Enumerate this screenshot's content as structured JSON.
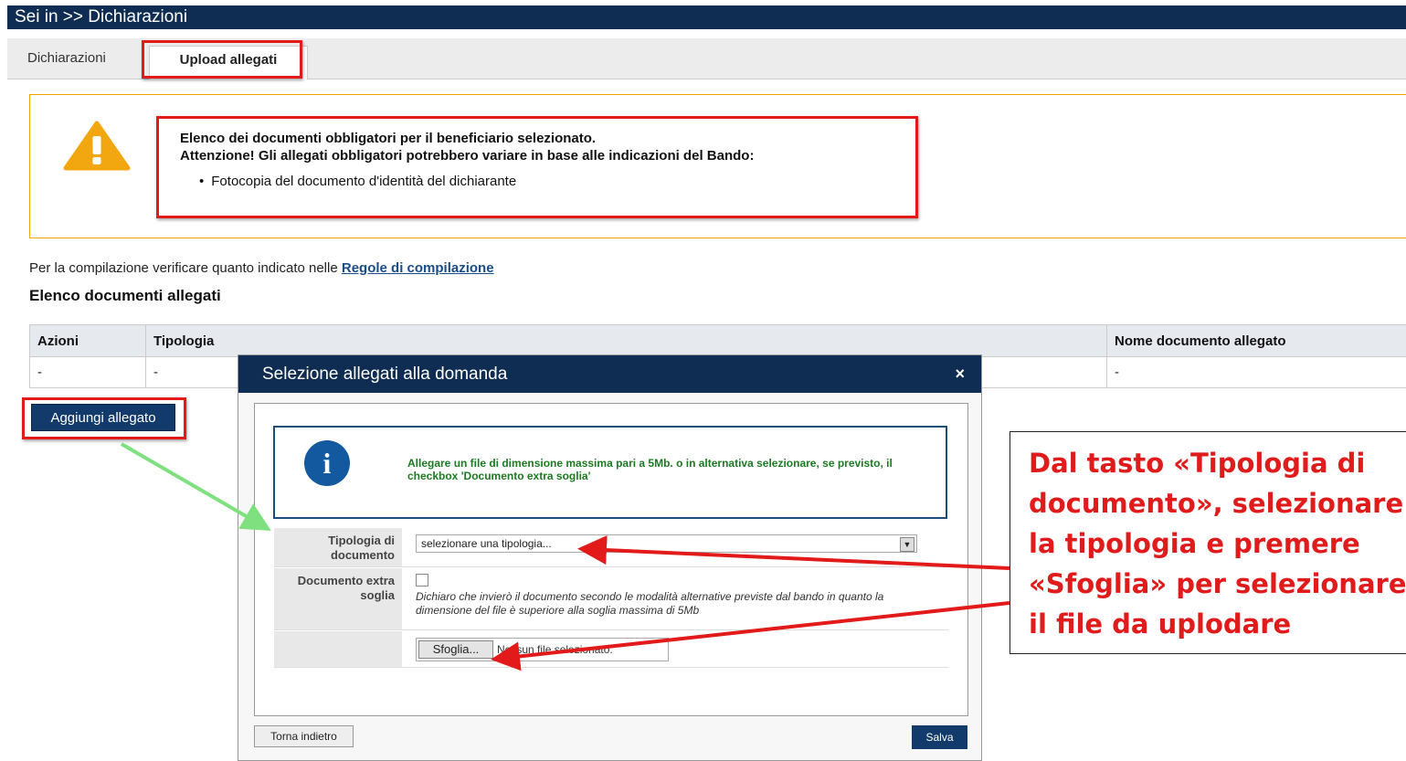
{
  "header": {
    "title": "Sei in >> Dichiarazioni"
  },
  "tabs": [
    {
      "label": "Dichiarazioni"
    },
    {
      "label": "Upload allegati"
    }
  ],
  "alert": {
    "line1": "Elenco dei documenti obbligatori per il beneficiario selezionato.",
    "line2": "Attenzione! Gli allegati obbligatori potrebbero variare in base alle indicazioni del Bando:",
    "item": "Fotocopia del documento d'identità del dichiarante"
  },
  "rules": {
    "prefix": "Per la compilazione verificare quanto indicato nelle ",
    "link": "Regole di compilazione"
  },
  "section_title": "Elenco documenti allegati",
  "table": {
    "headers": [
      "Azioni",
      "Tipologia",
      "Nome documento allegato"
    ],
    "row": [
      "-",
      "-",
      "-"
    ]
  },
  "add_button": "Aggiungi allegato",
  "modal": {
    "title": "Selezione allegati alla domanda",
    "close": "×",
    "info": "Allegare un file di dimensione massima pari a 5Mb. o in alternativa selezionare, se previsto, il checkbox 'Documento extra soglia'",
    "tipologia_label": "Tipologia di documento",
    "tipologia_value": "selezionare una tipologia...",
    "extra_label": "Documento extra soglia",
    "extra_text": "Dichiaro che invierò il documento secondo le modalità alternative previste dal bando in quanto la dimensione del file è superiore alla soglia massima di 5Mb",
    "browse_button": "Sfoglia...",
    "no_file": "Nessun file selezionato.",
    "back_button": "Torna indietro",
    "save_button": "Salva"
  },
  "annotation": "Dal tasto «Tipologia di documento», selezionare la tipologia e premere «Sfoglia» per selezionare il file da uplodare",
  "colors": {
    "brand": "#0f2d52",
    "highlight": "#e21a1a",
    "pointer": "#7fe07f",
    "info": "#1c7a22"
  }
}
